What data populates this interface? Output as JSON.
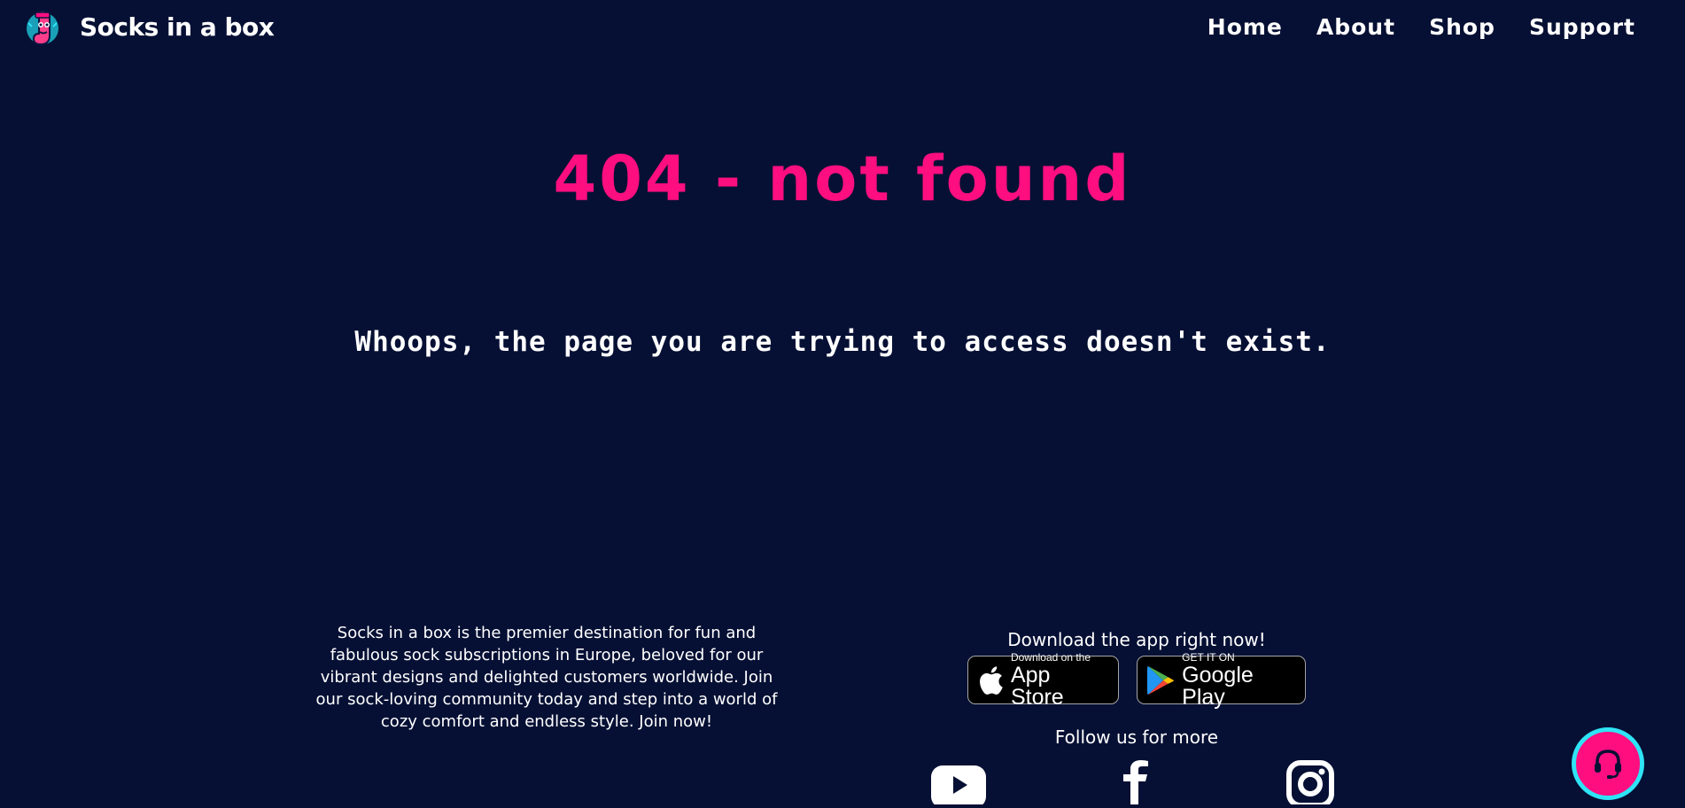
{
  "header": {
    "brand_name": "Socks in a box",
    "logo_icon": "sock-mascot-logo",
    "nav": [
      {
        "label": "Home"
      },
      {
        "label": "About"
      },
      {
        "label": "Shop"
      },
      {
        "label": "Support"
      }
    ]
  },
  "main": {
    "title": "404 - not found",
    "message": "Whoops, the page you are trying to access doesn't exist."
  },
  "footer": {
    "about_text": "Socks in a box is the premier destination for fun and fabulous sock subscriptions in Europe, beloved for our vibrant designs and delighted customers worldwide. Join our sock-loving community today and step into a world of cozy comfort and endless style. Join now!",
    "app_heading": "Download the app right now!",
    "app_store": {
      "small": "Download on the",
      "big": "App Store"
    },
    "google_play": {
      "small": "GET IT ON",
      "big": "Google Play"
    },
    "follow_heading": "Follow us for more",
    "social": [
      "youtube-icon",
      "facebook-icon",
      "instagram-icon"
    ]
  },
  "support_button": {
    "icon": "headset-icon"
  },
  "colors": {
    "background": "#061034",
    "accent_pink": "#ff0e80",
    "accent_cyan": "#2ee4f5",
    "text": "#ffffff"
  }
}
